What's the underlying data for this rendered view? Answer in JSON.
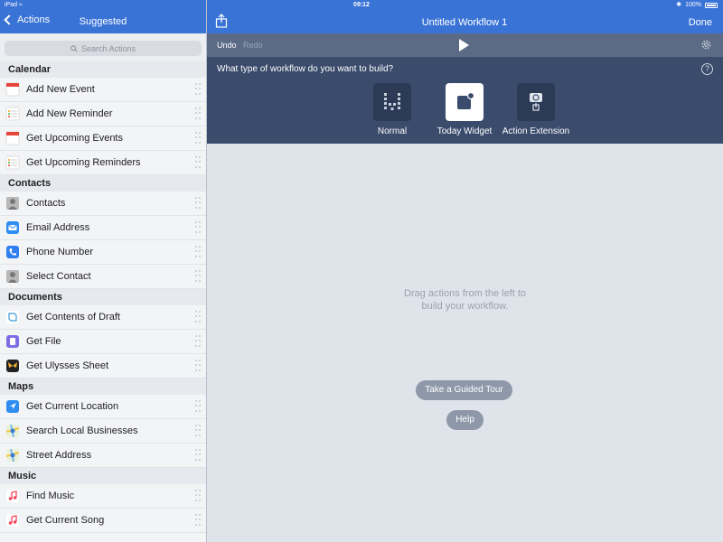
{
  "status": {
    "device": "iPad",
    "time": "09:12",
    "battery": "100%"
  },
  "left_nav": {
    "back_label": "Actions",
    "title": "Suggested"
  },
  "header": {
    "title": "Untitled Workflow 1",
    "done_label": "Done"
  },
  "search": {
    "placeholder": "Search Actions"
  },
  "sections": [
    {
      "title": "Calendar",
      "items": [
        {
          "label": "Add New Event",
          "icon": "calendar-icon"
        },
        {
          "label": "Add New Reminder",
          "icon": "reminders-icon"
        },
        {
          "label": "Get Upcoming Events",
          "icon": "calendar-icon"
        },
        {
          "label": "Get Upcoming Reminders",
          "icon": "reminders-icon"
        }
      ]
    },
    {
      "title": "Contacts",
      "items": [
        {
          "label": "Contacts",
          "icon": "contacts-icon"
        },
        {
          "label": "Email Address",
          "icon": "mail-icon"
        },
        {
          "label": "Phone Number",
          "icon": "phone-icon"
        },
        {
          "label": "Select Contact",
          "icon": "contacts-icon"
        }
      ]
    },
    {
      "title": "Documents",
      "items": [
        {
          "label": "Get Contents of Draft",
          "icon": "drafts-icon"
        },
        {
          "label": "Get File",
          "icon": "file-icon"
        },
        {
          "label": "Get Ulysses Sheet",
          "icon": "ulysses-icon"
        }
      ]
    },
    {
      "title": "Maps",
      "items": [
        {
          "label": "Get Current Location",
          "icon": "location-icon"
        },
        {
          "label": "Search Local Businesses",
          "icon": "maps-icon"
        },
        {
          "label": "Street Address",
          "icon": "maps-icon"
        }
      ]
    },
    {
      "title": "Music",
      "items": [
        {
          "label": "Find Music",
          "icon": "music-note-icon"
        },
        {
          "label": "Get Current Song",
          "icon": "music-note-icon"
        }
      ]
    }
  ],
  "toolbar": {
    "undo_label": "Undo",
    "redo_label": "Redo"
  },
  "chooser": {
    "question": "What type of workflow do you want to build?",
    "types": [
      {
        "label": "Normal",
        "selected": false
      },
      {
        "label": "Today Widget",
        "selected": true
      },
      {
        "label": "Action Extension",
        "selected": false
      }
    ]
  },
  "canvas": {
    "hint_line1": "Drag actions from the left to",
    "hint_line2": "build your workflow.",
    "tour_label": "Take a Guided Tour",
    "help_label": "Help"
  },
  "colors": {
    "header_blue": "#3a73d6",
    "toolbar": "#5c6b85",
    "chooser": "#3a4b6b",
    "canvas": "#dfe3ea"
  }
}
